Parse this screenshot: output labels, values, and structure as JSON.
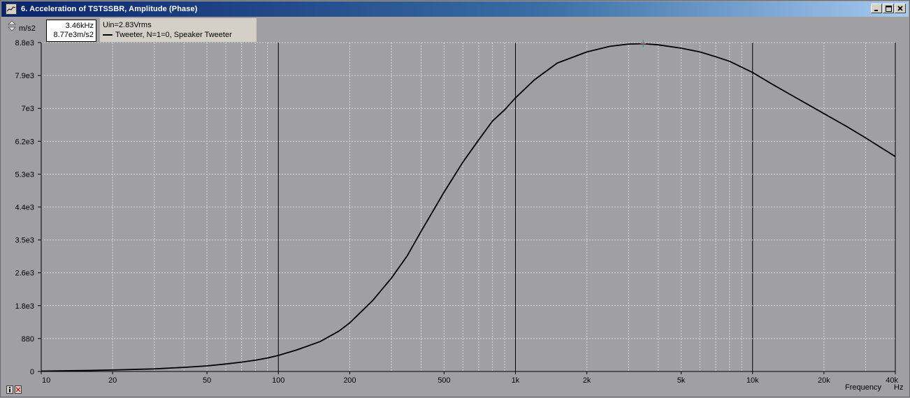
{
  "window": {
    "title": "6. Acceleration of TSTSSBR, Amplitude (Phase)",
    "minimize_label": "_",
    "maximize_label": "□",
    "close_label": "×"
  },
  "unit": "m/s2",
  "readout": {
    "freq": "3.46kHz",
    "value": "8.77e3m/s2"
  },
  "legend": {
    "line1": "Uin=2.83Vrms",
    "line2": "Tweeter, N=1=0, Speaker Tweeter"
  },
  "axis": {
    "x_caption": "Frequency",
    "x_unit": "Hz"
  },
  "chart_data": {
    "type": "line",
    "x_scale": "log",
    "xlim": [
      10,
      40000
    ],
    "ylim": [
      0,
      8800
    ],
    "x_ticks": [
      {
        "v": 10,
        "label": "10"
      },
      {
        "v": 20,
        "label": "20"
      },
      {
        "v": 50,
        "label": "50"
      },
      {
        "v": 100,
        "label": "100"
      },
      {
        "v": 200,
        "label": "200"
      },
      {
        "v": 500,
        "label": "500"
      },
      {
        "v": 1000,
        "label": "1k"
      },
      {
        "v": 2000,
        "label": "2k"
      },
      {
        "v": 5000,
        "label": "5k"
      },
      {
        "v": 10000,
        "label": "10k"
      },
      {
        "v": 20000,
        "label": "20k"
      },
      {
        "v": 40000,
        "label": "40k"
      }
    ],
    "y_ticks": [
      {
        "v": 0,
        "label": "0"
      },
      {
        "v": 880,
        "label": "880"
      },
      {
        "v": 1760,
        "label": "1.8e3"
      },
      {
        "v": 2640,
        "label": "2.6e3"
      },
      {
        "v": 3520,
        "label": "3.5e3"
      },
      {
        "v": 4400,
        "label": "4.4e3"
      },
      {
        "v": 5280,
        "label": "5.3e3"
      },
      {
        "v": 6160,
        "label": "6.2e3"
      },
      {
        "v": 7040,
        "label": "7e3"
      },
      {
        "v": 7920,
        "label": "7.9e3"
      },
      {
        "v": 8800,
        "label": "8.8e3"
      }
    ],
    "grid": true,
    "series": [
      {
        "name": "Tweeter, N=1=0, Speaker Tweeter",
        "color": "#000000",
        "points": [
          [
            10,
            10
          ],
          [
            15,
            25
          ],
          [
            20,
            40
          ],
          [
            30,
            70
          ],
          [
            40,
            110
          ],
          [
            50,
            150
          ],
          [
            60,
            200
          ],
          [
            70,
            250
          ],
          [
            80,
            300
          ],
          [
            90,
            360
          ],
          [
            100,
            430
          ],
          [
            120,
            580
          ],
          [
            150,
            800
          ],
          [
            180,
            1080
          ],
          [
            200,
            1300
          ],
          [
            250,
            1900
          ],
          [
            300,
            2500
          ],
          [
            350,
            3100
          ],
          [
            400,
            3750
          ],
          [
            500,
            4800
          ],
          [
            600,
            5600
          ],
          [
            700,
            6200
          ],
          [
            800,
            6700
          ],
          [
            900,
            7000
          ],
          [
            1000,
            7320
          ],
          [
            1200,
            7800
          ],
          [
            1500,
            8250
          ],
          [
            2000,
            8550
          ],
          [
            2500,
            8700
          ],
          [
            3000,
            8760
          ],
          [
            3460,
            8770
          ],
          [
            4000,
            8740
          ],
          [
            5000,
            8650
          ],
          [
            6000,
            8550
          ],
          [
            7000,
            8420
          ],
          [
            8000,
            8300
          ],
          [
            10000,
            8000
          ],
          [
            12000,
            7700
          ],
          [
            15000,
            7350
          ],
          [
            20000,
            6900
          ],
          [
            25000,
            6550
          ],
          [
            30000,
            6250
          ],
          [
            35000,
            5980
          ],
          [
            40000,
            5750
          ]
        ]
      }
    ],
    "cursor": {
      "x": 3460,
      "y": 8770
    }
  }
}
